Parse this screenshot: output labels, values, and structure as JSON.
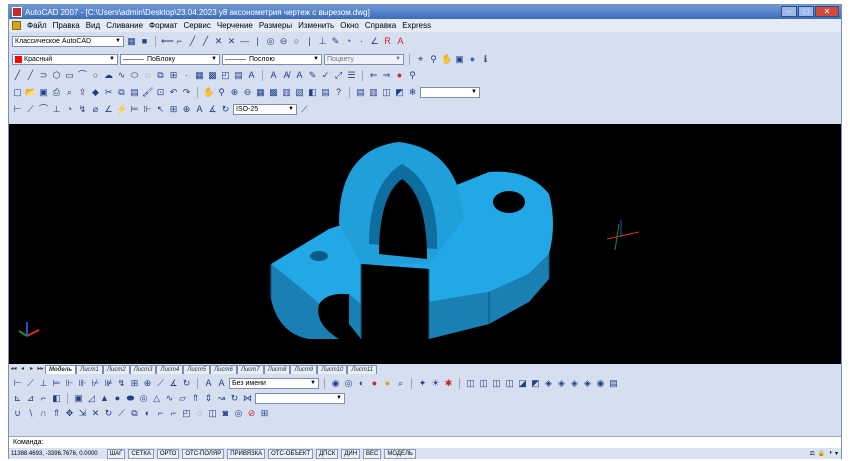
{
  "titlebar": {
    "title": "AutoCAD 2007 - [C:\\Users\\admin\\Desktop\\23.04.2023 у8 аксонометрия чертеж с вырезом.dwg]",
    "minimize": "–",
    "maximize": "□",
    "close": "✕"
  },
  "menu": [
    "Файл",
    "Правка",
    "Вид",
    "Сливание",
    "Формат",
    "Сервис",
    "Черчение",
    "Размеры",
    "Изменить",
    "Окно",
    "Справка",
    "Express"
  ],
  "toolbar": {
    "workspace": "Классическое AutoCAD",
    "color": "Красный",
    "color_hex": "#ff0000",
    "linetype": "ПоБлоку",
    "lineweight": "Послою",
    "plotstyle": "Поцвету",
    "dimstyle": "ISO-25",
    "text_style": "Без имени"
  },
  "tabs": [
    "Модель",
    "Лист1",
    "Лист2",
    "Лист3",
    "Лист4",
    "Лист5",
    "Лист6",
    "Лист7",
    "Лист8",
    "Лист9",
    "Лист10",
    "Лист11"
  ],
  "tab_nav": [
    "◂◂",
    "◂",
    "▸",
    "▸▸"
  ],
  "command": {
    "prompt": "Команда:"
  },
  "status": {
    "coords": "11388.4693, -3396.7676, 0.0000",
    "buttons": [
      "ШАГ",
      "СЕТКА",
      "ОРТО",
      "ОТС-ПОЛЯР",
      "ПРИВЯЗКА",
      "ОТС-ОБЪЕКТ",
      "ДПСК",
      "ДИН",
      "ВЕС",
      "МОДЕЛЬ"
    ]
  },
  "colors": {
    "model_fill": "#1fa0db",
    "viewport_bg": "#000000"
  }
}
